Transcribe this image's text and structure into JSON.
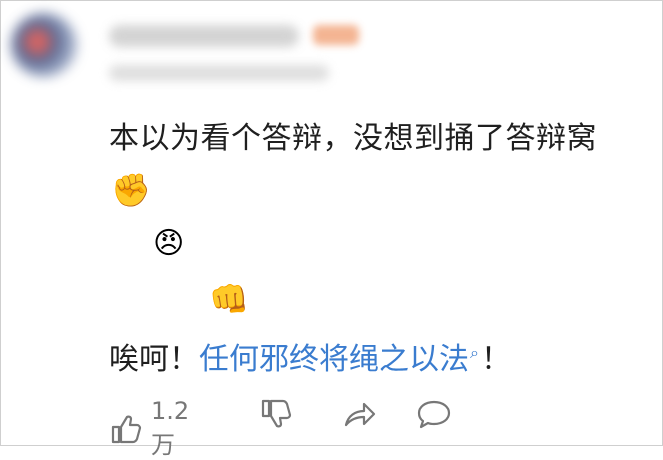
{
  "comment": {
    "text_line1": "本以为看个答辩，没想到捅了答辩窝",
    "emojis": [
      "✊",
      "😠",
      "👊"
    ],
    "text_line2_prefix": "唉呵！",
    "link_text": "任何邪终将绳之以法",
    "text_line2_suffix": "！"
  },
  "actions": {
    "like_count": "1.2万"
  },
  "icons": {
    "search": "search-icon",
    "like": "thumbs-up-icon",
    "dislike": "thumbs-down-icon",
    "share": "share-arrow-icon",
    "comment": "comment-bubble-icon"
  },
  "colors": {
    "link": "#3a7ccf",
    "text": "#1f1f1f",
    "icon": "#777777"
  }
}
